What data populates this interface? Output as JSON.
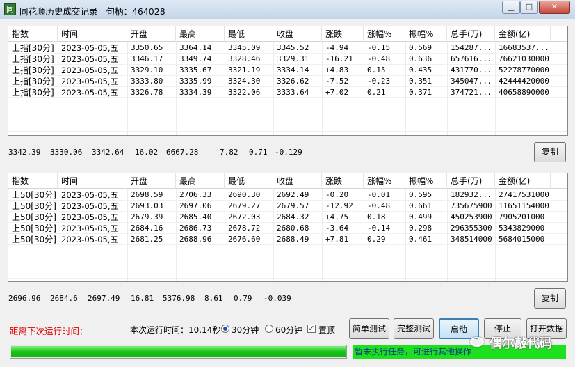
{
  "window": {
    "title": "同花顺历史成交记录",
    "handle_label": "句柄：",
    "handle_value": "464028",
    "icon_glyph": "同",
    "min_glyph": "▁",
    "max_glyph": "□",
    "close_glyph": "✕"
  },
  "columns": [
    "指数",
    "时间",
    "开盘",
    "最高",
    "最低",
    "收盘",
    "涨跌",
    "涨幅%",
    "振幅%",
    "总手(万)",
    "金额(亿)"
  ],
  "table_top": [
    [
      "上指[30分]",
      "2023-05-05,五",
      "3350.65",
      "3364.14",
      "3345.09",
      "3345.52",
      "-4.94",
      "-0.15",
      "0.569",
      "154287...",
      "16683537..."
    ],
    [
      "上指[30分]",
      "2023-05-05,五",
      "3346.17",
      "3349.74",
      "3328.46",
      "3329.31",
      "-16.21",
      "-0.48",
      "0.636",
      "657616...",
      "76621030000"
    ],
    [
      "上指[30分]",
      "2023-05-05,五",
      "3329.10",
      "3335.67",
      "3321.19",
      "3334.14",
      "+4.83",
      "0.15",
      "0.435",
      "431770...",
      "52278770000"
    ],
    [
      "上指[30分]",
      "2023-05-05,五",
      "3333.80",
      "3335.99",
      "3324.30",
      "3326.62",
      "-7.52",
      "-0.23",
      "0.351",
      "345047...",
      "42444420000"
    ],
    [
      "上指[30分]",
      "2023-05-05,五",
      "3326.78",
      "3334.39",
      "3322.06",
      "3333.64",
      "+7.02",
      "0.21",
      "0.371",
      "374721...",
      "40658890000"
    ]
  ],
  "summary_top": [
    "3342.39",
    "3330.06",
    "3342.64",
    "16.02",
    "6667.28",
    "7.82",
    "0.71",
    "-0.129"
  ],
  "table_bottom": [
    [
      "上50[30分]",
      "2023-05-05,五",
      "2698.59",
      "2706.33",
      "2690.30",
      "2692.49",
      "-0.20",
      "-0.01",
      "0.595",
      "182932...",
      "27417531000"
    ],
    [
      "上50[30分]",
      "2023-05-05,五",
      "2693.03",
      "2697.06",
      "2679.27",
      "2679.57",
      "-12.92",
      "-0.48",
      "0.661",
      "735675900",
      "11651154000"
    ],
    [
      "上50[30分]",
      "2023-05-05,五",
      "2679.39",
      "2685.40",
      "2672.03",
      "2684.32",
      "+4.75",
      "0.18",
      "0.499",
      "450253900",
      "7905201000"
    ],
    [
      "上50[30分]",
      "2023-05-05,五",
      "2684.16",
      "2686.73",
      "2678.72",
      "2680.68",
      "-3.64",
      "-0.14",
      "0.298",
      "296355300",
      "5343829000"
    ],
    [
      "上50[30分]",
      "2023-05-05,五",
      "2681.25",
      "2688.96",
      "2676.60",
      "2688.49",
      "+7.81",
      "0.29",
      "0.461",
      "348514000",
      "5684015000"
    ]
  ],
  "summary_bottom": [
    "2696.96",
    "2684.6",
    "2697.49",
    "16.81",
    "5376.98",
    "8.61",
    "0.79",
    "-0.039"
  ],
  "buttons": {
    "copy": "复制",
    "simple_test": "简单测试",
    "full_test": "完整测试",
    "start": "启动",
    "stop": "停止",
    "open_data": "打开数据"
  },
  "controls": {
    "next_run_label": "距离下次运行时间：",
    "run_time_label": "本次运行时间：10.14秒",
    "radio_30": "30分钟",
    "radio_60": "60分钟",
    "radio_selected": "30分钟",
    "pin_label": "置顶",
    "pin_checked": true,
    "checkmark": "✓"
  },
  "progress": {
    "fraction": 1.0
  },
  "status_text": "暂未执行任务，可进行其他操作",
  "watermark": "偶尔敲代码",
  "colors": {
    "status_green": "#1ee01e",
    "progress_green": "#18c318",
    "next_run_red": "#e00000"
  }
}
